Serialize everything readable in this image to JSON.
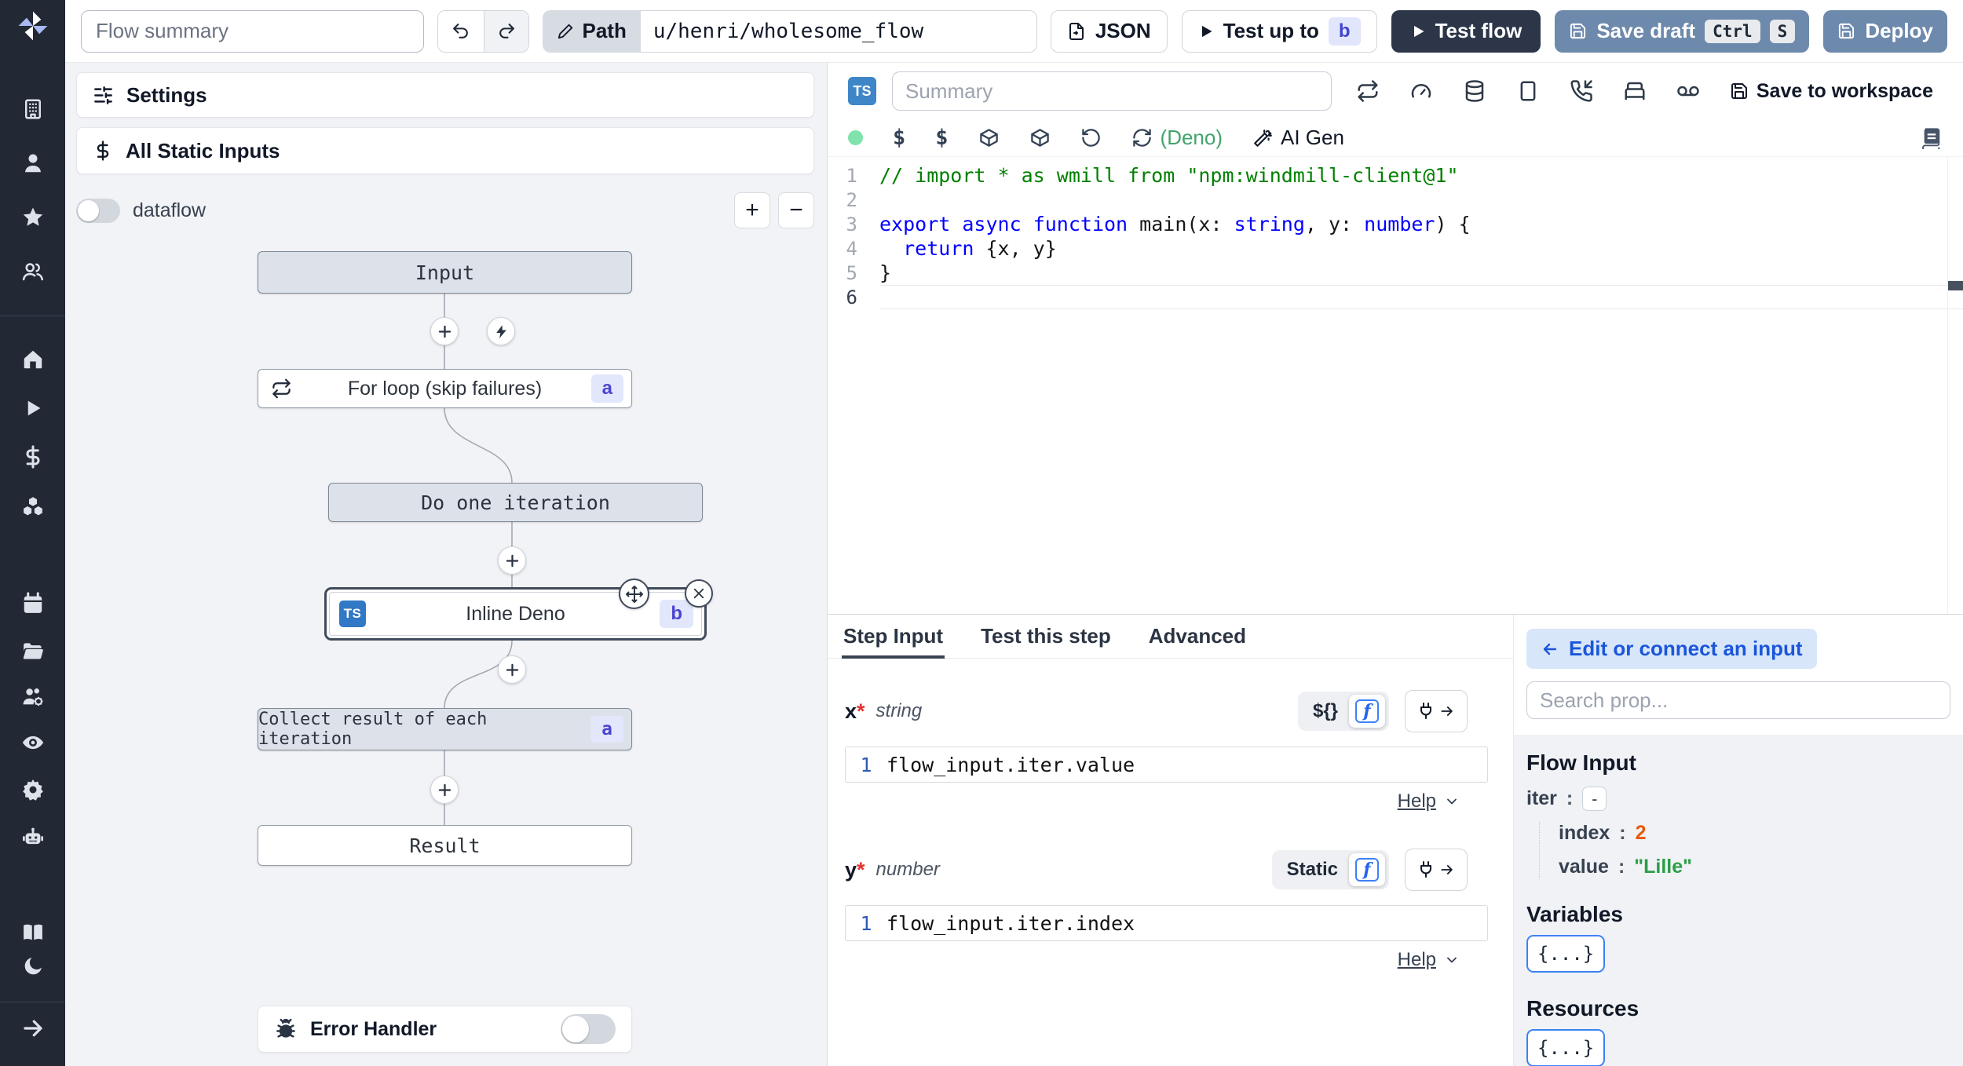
{
  "topbar": {
    "flow_summary_placeholder": "Flow summary",
    "path_button": "Path",
    "path_value": "u/henri/wholesome_flow",
    "json_button": "JSON",
    "test_up_to_button": "Test up to",
    "test_up_to_badge": "b",
    "test_flow_button": "Test flow",
    "save_draft_button": "Save draft",
    "kbd_ctrl": "Ctrl",
    "kbd_s": "S",
    "deploy_button": "Deploy"
  },
  "sidebar": {
    "icons": [
      "windmill-logo",
      "building",
      "user",
      "star",
      "users",
      "home",
      "play",
      "dollar",
      "boxes",
      "calendar",
      "folder-open",
      "users-gear",
      "eye",
      "settings-gear",
      "robot",
      "book-open",
      "moon",
      "arrow-right"
    ]
  },
  "flow_panel": {
    "settings_button": "Settings",
    "static_inputs_button": "All Static Inputs",
    "dataflow_toggle_label": "dataflow",
    "zoom_in": "+",
    "zoom_out": "−",
    "error_handler_label": "Error Handler",
    "nodes": {
      "input": {
        "label": "Input"
      },
      "forloop": {
        "label": "For loop (skip failures)",
        "badge": "a"
      },
      "do_one": {
        "label": "Do one iteration"
      },
      "inline": {
        "label": "Inline Deno",
        "badge": "b",
        "lang": "TS"
      },
      "collect": {
        "label": "Collect result of each iteration",
        "badge": "a"
      },
      "result": {
        "label": "Result"
      }
    }
  },
  "editor": {
    "lang_badge": "TS",
    "summary_placeholder": "Summary",
    "save_to_workspace": "Save to workspace",
    "runtime": "(Deno)",
    "ai_gen": "AI Gen",
    "code": {
      "lines": [
        {
          "num": 1,
          "tokens": [
            {
              "t": "// import * as wmill from \"npm:windmill-client@1\"",
              "c": "cm"
            }
          ]
        },
        {
          "num": 2,
          "tokens": []
        },
        {
          "num": 3,
          "tokens": [
            {
              "t": "export",
              "c": "kw"
            },
            {
              "t": " ",
              "c": "pl"
            },
            {
              "t": "async",
              "c": "kw"
            },
            {
              "t": " ",
              "c": "pl"
            },
            {
              "t": "function",
              "c": "kw"
            },
            {
              "t": " main(x: ",
              "c": "pl"
            },
            {
              "t": "string",
              "c": "kw"
            },
            {
              "t": ", y: ",
              "c": "pl"
            },
            {
              "t": "number",
              "c": "kw"
            },
            {
              "t": ") {",
              "c": "pl"
            }
          ]
        },
        {
          "num": 4,
          "tokens": [
            {
              "t": "  ",
              "c": "pl"
            },
            {
              "t": "return",
              "c": "kw"
            },
            {
              "t": " {x, y}",
              "c": "pl"
            }
          ]
        },
        {
          "num": 5,
          "tokens": [
            {
              "t": "}",
              "c": "pl"
            }
          ]
        },
        {
          "num": 6,
          "tokens": [],
          "active": true
        }
      ]
    }
  },
  "step_panel": {
    "tabs": [
      "Step Input",
      "Test this step",
      "Advanced"
    ],
    "fields": [
      {
        "name": "x",
        "required": "*",
        "type": "string",
        "mode": "${}",
        "line_no": "1",
        "expr": "flow_input.iter.value",
        "help": "Help"
      },
      {
        "name": "y",
        "required": "*",
        "type": "number",
        "mode": "Static",
        "line_no": "1",
        "expr": "flow_input.iter.index",
        "help": "Help"
      }
    ]
  },
  "connect_panel": {
    "edit_button": "Edit or connect an input",
    "search_placeholder": "Search prop...",
    "flow_input_title": "Flow Input",
    "iter_key": "iter",
    "iter_colon": ":",
    "iter_toggle": "-",
    "index_key": "index",
    "index_value": "2",
    "value_key": "value",
    "value_value": "\"Lille\"",
    "variables_title": "Variables",
    "variables_button": "{...}",
    "resources_title": "Resources",
    "resources_button": "{...}"
  },
  "colors": {
    "sidebar_bg": "#222834",
    "steel_button": "#6d89ac",
    "dark_button": "#2c3648",
    "node_gray": "#dde2ea",
    "badge_bg": "#e2e7fc",
    "badge_text": "#4a45d1",
    "status_dot_green": "#7fe3ab",
    "deno_green": "#41a46b",
    "comment_green": "#008000",
    "keyword_blue": "#0000ff",
    "index_orange": "#e8590c",
    "value_green": "#2b9e48",
    "edit_input_bg": "#d8e6fa",
    "edit_input_text": "#1a56db"
  }
}
